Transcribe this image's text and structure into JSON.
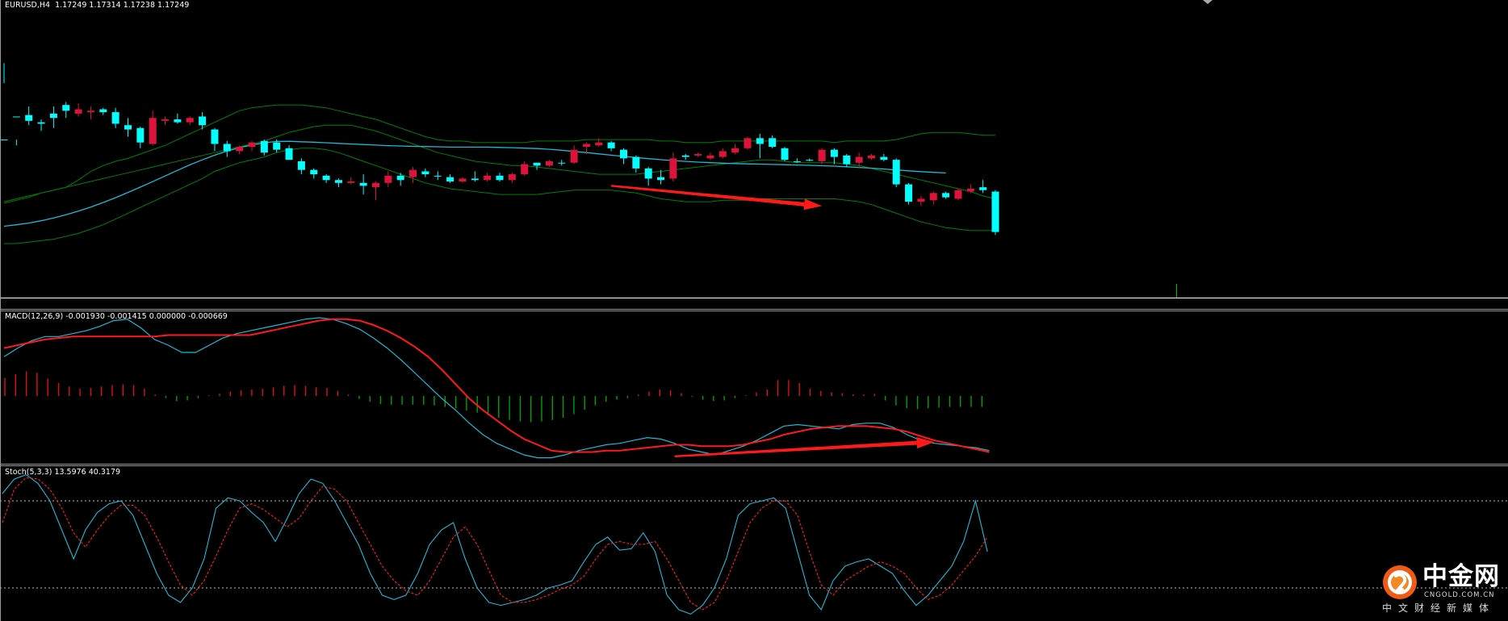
{
  "symbol_header": "EURUSD,H4  1.17249 1.17314 1.17238 1.17249",
  "colors": {
    "background": "#000000",
    "bull_candle": "#dc143c",
    "bear_candle": "#00ffff",
    "bollinger": "#008000",
    "moving_average": "#1fb9d6",
    "macd_line": "#1fb9d6",
    "signal_line": "#ff1a1a",
    "hist_positive": "#dd1111",
    "hist_negative": "#00a000",
    "stoch_main": "#1fb9d6",
    "stoch_signal": "#ff2020",
    "annotation_arrow": "#ff1a1a",
    "separator": "#ffffff"
  },
  "chart_data": [
    {
      "type": "candlestick",
      "title": "EURUSD,H4",
      "ohlc_readout": [
        1.17249,
        1.17314,
        1.17238,
        1.17249
      ],
      "candles": [
        [
          0.1,
          0.1,
          0.63,
          0.49
        ],
        [
          0.26,
          0.26,
          0.1,
          0.06
        ],
        [
          0.27,
          0.23,
          0.33,
          0.2
        ],
        [
          0.22,
          0.21,
          0.24,
          0.16
        ],
        [
          0.28,
          0.25,
          0.33,
          0.18
        ],
        [
          0.34,
          0.3,
          0.36,
          0.25
        ],
        [
          0.28,
          0.31,
          0.35,
          0.26
        ],
        [
          0.29,
          0.3,
          0.33,
          0.24
        ],
        [
          0.31,
          0.29,
          0.32,
          0.27
        ],
        [
          0.29,
          0.21,
          0.32,
          0.18
        ],
        [
          0.2,
          0.17,
          0.25,
          0.12
        ],
        [
          0.18,
          0.08,
          0.19,
          0.04
        ],
        [
          0.07,
          0.25,
          0.3,
          0.06
        ],
        [
          0.23,
          0.24,
          0.26,
          0.2
        ],
        [
          0.24,
          0.22,
          0.28,
          0.21
        ],
        [
          0.22,
          0.25,
          0.26,
          0.2
        ],
        [
          0.26,
          0.2,
          0.29,
          0.17
        ],
        [
          0.17,
          0.07,
          0.18,
          0.02
        ],
        [
          0.07,
          0.02,
          0.09,
          -0.02
        ],
        [
          0.02,
          0.05,
          0.06,
          0.0
        ],
        [
          0.05,
          0.08,
          0.09,
          0.02
        ],
        [
          0.09,
          0.01,
          0.1,
          -0.01
        ],
        [
          0.08,
          0.03,
          0.1,
          0.01
        ],
        [
          0.04,
          -0.04,
          0.06,
          -0.04
        ],
        [
          -0.05,
          -0.11,
          -0.03,
          -0.14
        ],
        [
          -0.11,
          -0.14,
          -0.1,
          -0.17
        ],
        [
          -0.15,
          -0.18,
          -0.14,
          -0.2
        ],
        [
          -0.18,
          -0.2,
          -0.17,
          -0.23
        ],
        [
          -0.2,
          -0.19,
          -0.16,
          -0.21
        ],
        [
          -0.2,
          -0.22,
          -0.14,
          -0.28
        ],
        [
          -0.23,
          -0.2,
          -0.19,
          -0.32
        ],
        [
          -0.2,
          -0.15,
          -0.12,
          -0.23
        ],
        [
          -0.15,
          -0.18,
          -0.13,
          -0.22
        ],
        [
          -0.16,
          -0.11,
          -0.09,
          -0.2
        ],
        [
          -0.12,
          -0.14,
          -0.1,
          -0.16
        ],
        [
          -0.15,
          -0.15,
          -0.12,
          -0.18
        ],
        [
          -0.16,
          -0.19,
          -0.14,
          -0.2
        ],
        [
          -0.19,
          -0.17,
          -0.16,
          -0.2
        ],
        [
          -0.17,
          -0.18,
          -0.12,
          -0.19
        ],
        [
          -0.18,
          -0.15,
          -0.13,
          -0.19
        ],
        [
          -0.15,
          -0.18,
          -0.13,
          -0.19
        ],
        [
          -0.18,
          -0.14,
          -0.13,
          -0.2
        ],
        [
          -0.14,
          -0.07,
          -0.05,
          -0.15
        ],
        [
          -0.06,
          -0.08,
          -0.06,
          -0.11
        ],
        [
          -0.08,
          -0.05,
          -0.04,
          -0.09
        ],
        [
          -0.06,
          -0.06,
          -0.04,
          -0.08
        ],
        [
          -0.06,
          0.03,
          0.06,
          -0.07
        ],
        [
          0.05,
          0.07,
          0.08,
          0.0
        ],
        [
          0.06,
          0.08,
          0.11,
          0.05
        ],
        [
          0.08,
          0.04,
          0.09,
          0.02
        ],
        [
          0.03,
          -0.03,
          0.04,
          -0.07
        ],
        [
          -0.02,
          -0.1,
          -0.01,
          -0.13
        ],
        [
          -0.1,
          -0.17,
          -0.09,
          -0.22
        ],
        [
          -0.16,
          -0.18,
          -0.11,
          -0.21
        ],
        [
          -0.17,
          -0.03,
          0.01,
          -0.19
        ],
        [
          -0.01,
          -0.02,
          0.0,
          -0.04
        ],
        [
          -0.01,
          0.0,
          0.01,
          -0.02
        ],
        [
          -0.03,
          -0.01,
          0.01,
          -0.04
        ],
        [
          -0.02,
          0.02,
          0.04,
          -0.03
        ],
        [
          0.01,
          0.04,
          0.07,
          0.0
        ],
        [
          0.04,
          0.11,
          0.12,
          0.03
        ],
        [
          0.11,
          0.07,
          0.14,
          -0.03
        ],
        [
          0.11,
          0.05,
          0.13,
          0.04
        ],
        [
          0.04,
          -0.04,
          0.05,
          -0.05
        ],
        [
          -0.05,
          -0.05,
          -0.03,
          -0.06
        ],
        [
          -0.04,
          -0.04,
          -0.03,
          -0.05
        ],
        [
          -0.05,
          0.03,
          0.04,
          -0.07
        ],
        [
          0.03,
          -0.02,
          0.04,
          -0.07
        ],
        [
          -0.01,
          -0.07,
          0.0,
          -0.09
        ],
        [
          -0.06,
          -0.02,
          0.01,
          -0.1
        ],
        [
          -0.03,
          -0.01,
          0.0,
          -0.04
        ],
        [
          -0.02,
          -0.04,
          0.0,
          -0.05
        ],
        [
          -0.04,
          -0.21,
          -0.03,
          -0.23
        ],
        [
          -0.21,
          -0.33,
          -0.2,
          -0.35
        ],
        [
          -0.33,
          -0.31,
          -0.29,
          -0.36
        ],
        [
          -0.32,
          -0.27,
          -0.26,
          -0.35
        ],
        [
          -0.27,
          -0.3,
          -0.26,
          -0.31
        ],
        [
          -0.31,
          -0.25,
          -0.24,
          -0.32
        ],
        [
          -0.26,
          -0.24,
          -0.21,
          -0.27
        ],
        [
          -0.23,
          -0.25,
          -0.18,
          -0.27
        ],
        [
          -0.26,
          -0.54,
          -0.25,
          -0.56
        ]
      ],
      "moving_average": [
        -0.5,
        -0.49,
        -0.478,
        -0.462,
        -0.443,
        -0.42,
        -0.395,
        -0.367,
        -0.336,
        -0.302,
        -0.266,
        -0.229,
        -0.191,
        -0.152,
        -0.113,
        -0.075,
        -0.04,
        -0.008,
        0.02,
        0.044,
        0.063,
        0.078,
        0.087,
        0.088,
        0.085,
        0.082,
        0.078,
        0.074,
        0.07,
        0.066,
        0.062,
        0.058,
        0.056,
        0.053,
        0.052,
        0.05,
        0.048,
        0.048,
        0.048,
        0.048,
        0.046,
        0.044,
        0.041,
        0.038,
        0.033,
        0.026,
        0.018,
        0.01,
        0.001,
        -0.008,
        -0.016,
        -0.024,
        -0.032,
        -0.039,
        -0.045,
        -0.051,
        -0.056,
        -0.06,
        -0.063,
        -0.066,
        -0.068,
        -0.07,
        -0.072,
        -0.074,
        -0.076,
        -0.078,
        -0.081,
        -0.084,
        -0.088,
        -0.093,
        -0.098,
        -0.104,
        -0.11,
        -0.116,
        -0.122,
        -0.127,
        -0.131
      ],
      "bollinger_upper": [
        -0.34,
        -0.32,
        -0.3,
        -0.27,
        -0.25,
        -0.23,
        -0.18,
        -0.12,
        -0.08,
        -0.05,
        -0.03,
        0.0,
        0.03,
        0.06,
        0.1,
        0.14,
        0.18,
        0.22,
        0.26,
        0.3,
        0.32,
        0.33,
        0.34,
        0.34,
        0.34,
        0.33,
        0.32,
        0.3,
        0.28,
        0.26,
        0.24,
        0.21,
        0.18,
        0.15,
        0.12,
        0.1,
        0.09,
        0.09,
        0.08,
        0.08,
        0.08,
        0.08,
        0.08,
        0.09,
        0.09,
        0.09,
        0.09,
        0.1,
        0.1,
        0.1,
        0.1,
        0.1,
        0.1,
        0.09,
        0.09,
        0.08,
        0.08,
        0.08,
        0.09,
        0.09,
        0.09,
        0.09,
        0.09,
        0.09,
        0.09,
        0.09,
        0.09,
        0.08,
        0.09,
        0.09,
        0.09,
        0.09,
        0.1,
        0.12,
        0.14,
        0.15,
        0.15,
        0.15,
        0.14,
        0.13,
        0.13
      ],
      "bollinger_middle": [
        -0.33,
        -0.31,
        -0.29,
        -0.27,
        -0.25,
        -0.23,
        -0.21,
        -0.19,
        -0.17,
        -0.15,
        -0.13,
        -0.11,
        -0.09,
        -0.07,
        -0.05,
        -0.03,
        -0.01,
        0.01,
        0.03,
        0.05,
        0.07,
        0.09,
        0.12,
        0.15,
        0.17,
        0.19,
        0.2,
        0.2,
        0.2,
        0.18,
        0.16,
        0.13,
        0.1,
        0.07,
        0.04,
        0.01,
        -0.01,
        -0.03,
        -0.05,
        -0.06,
        -0.07,
        -0.08,
        -0.08,
        -0.09,
        -0.1,
        -0.11,
        -0.12,
        -0.13,
        -0.14,
        -0.14,
        -0.14,
        -0.14,
        -0.13,
        -0.12,
        -0.11,
        -0.1,
        -0.09,
        -0.08,
        -0.07,
        -0.06,
        -0.05,
        -0.04,
        -0.04,
        -0.05,
        -0.06,
        -0.06,
        -0.06,
        -0.06,
        -0.07,
        -0.08,
        -0.1,
        -0.12,
        -0.14,
        -0.16,
        -0.18,
        -0.2,
        -0.22,
        -0.24,
        -0.26,
        -0.29,
        -0.31
      ],
      "bollinger_lower": [
        -0.62,
        -0.62,
        -0.61,
        -0.6,
        -0.59,
        -0.57,
        -0.55,
        -0.52,
        -0.49,
        -0.45,
        -0.41,
        -0.37,
        -0.33,
        -0.29,
        -0.25,
        -0.21,
        -0.17,
        -0.12,
        -0.09,
        -0.06,
        -0.04,
        -0.02,
        0.01,
        0.03,
        0.04,
        0.04,
        0.03,
        0.01,
        -0.02,
        -0.05,
        -0.08,
        -0.11,
        -0.14,
        -0.17,
        -0.2,
        -0.22,
        -0.24,
        -0.25,
        -0.26,
        -0.27,
        -0.28,
        -0.28,
        -0.28,
        -0.28,
        -0.27,
        -0.26,
        -0.25,
        -0.25,
        -0.25,
        -0.25,
        -0.26,
        -0.27,
        -0.29,
        -0.31,
        -0.32,
        -0.33,
        -0.33,
        -0.33,
        -0.32,
        -0.32,
        -0.32,
        -0.31,
        -0.31,
        -0.31,
        -0.31,
        -0.31,
        -0.31,
        -0.31,
        -0.32,
        -0.33,
        -0.35,
        -0.38,
        -0.41,
        -0.44,
        -0.47,
        -0.49,
        -0.51,
        -0.52,
        -0.53,
        -0.53,
        -0.53
      ],
      "annotation_arrow": {
        "from_bar": 49,
        "from_value": -0.22,
        "to_bar": 66,
        "to_value": -0.36
      }
    },
    {
      "type": "line",
      "title": "MACD(12,26,9)",
      "readout": "-0.001930 -0.001415 0.000000 -0.000669",
      "macd": [
        0.73,
        0.79,
        0.84,
        0.87,
        0.87,
        0.89,
        0.91,
        0.94,
        0.98,
        0.99,
        0.93,
        0.85,
        0.81,
        0.76,
        0.76,
        0.81,
        0.86,
        0.89,
        0.91,
        0.93,
        0.95,
        0.97,
        0.99,
        1.0,
        0.99,
        0.96,
        0.92,
        0.86,
        0.79,
        0.71,
        0.62,
        0.53,
        0.44,
        0.36,
        0.27,
        0.19,
        0.13,
        0.09,
        0.05,
        0.03,
        0.03,
        0.05,
        0.08,
        0.1,
        0.12,
        0.13,
        0.15,
        0.17,
        0.16,
        0.13,
        0.09,
        0.07,
        0.05,
        0.08,
        0.11,
        0.15,
        0.2,
        0.25,
        0.26,
        0.25,
        0.24,
        0.23,
        0.26,
        0.27,
        0.27,
        0.24,
        0.19,
        0.15,
        0.13,
        0.12,
        0.11,
        0.1,
        0.08
      ],
      "signal": [
        0.79,
        0.81,
        0.83,
        0.85,
        0.86,
        0.87,
        0.87,
        0.87,
        0.87,
        0.87,
        0.87,
        0.87,
        0.88,
        0.88,
        0.88,
        0.88,
        0.88,
        0.88,
        0.88,
        0.9,
        0.92,
        0.94,
        0.96,
        0.98,
        0.99,
        0.99,
        0.98,
        0.95,
        0.91,
        0.86,
        0.8,
        0.73,
        0.64,
        0.54,
        0.44,
        0.36,
        0.29,
        0.22,
        0.16,
        0.12,
        0.08,
        0.07,
        0.07,
        0.07,
        0.08,
        0.08,
        0.09,
        0.1,
        0.11,
        0.12,
        0.12,
        0.11,
        0.11,
        0.11,
        0.12,
        0.14,
        0.16,
        0.19,
        0.21,
        0.23,
        0.24,
        0.25,
        0.25,
        0.25,
        0.24,
        0.23,
        0.21,
        0.18,
        0.15,
        0.13,
        0.11,
        0.09,
        0.07
      ],
      "histogram": [
        0.25,
        0.3,
        0.34,
        0.32,
        0.24,
        0.18,
        0.13,
        0.1,
        0.11,
        0.13,
        0.15,
        0.16,
        0.15,
        0.1,
        0.02,
        -0.03,
        -0.07,
        -0.06,
        -0.03,
        0.01,
        0.03,
        0.06,
        0.08,
        0.09,
        0.1,
        0.12,
        0.14,
        0.15,
        0.14,
        0.12,
        0.11,
        0.07,
        0.02,
        -0.04,
        -0.08,
        -0.11,
        -0.12,
        -0.12,
        -0.12,
        -0.12,
        -0.13,
        -0.15,
        -0.17,
        -0.2,
        -0.23,
        -0.26,
        -0.3,
        -0.33,
        -0.35,
        -0.36,
        -0.35,
        -0.33,
        -0.3,
        -0.25,
        -0.19,
        -0.13,
        -0.08,
        -0.05,
        -0.03,
        0.02,
        0.06,
        0.09,
        0.08,
        0.04,
        -0.01,
        -0.05,
        -0.07,
        -0.06,
        -0.03,
        0.01,
        0.05,
        0.09,
        0.22,
        0.22,
        0.18,
        0.1,
        0.07,
        0.05,
        0.04,
        0.02,
        0.02,
        0.03,
        -0.06,
        -0.13,
        -0.17,
        -0.18,
        -0.17,
        -0.16,
        -0.15,
        -0.15,
        -0.15,
        -0.15
      ],
      "annotation_arrow": {
        "from_bar": 49,
        "from_value": 0.04,
        "to_bar": 68,
        "to_value": 0.14
      }
    },
    {
      "type": "line",
      "title": "Stoch(5,3,3)",
      "readout": "13.5976 40.3179",
      "levels": [
        80,
        20
      ],
      "main": [
        85,
        95,
        98,
        92,
        80,
        60,
        40,
        60,
        72,
        78,
        80,
        70,
        50,
        30,
        15,
        10,
        20,
        40,
        75,
        82,
        80,
        72,
        65,
        52,
        68,
        85,
        95,
        92,
        80,
        65,
        50,
        30,
        15,
        12,
        15,
        30,
        50,
        60,
        65,
        40,
        20,
        10,
        8,
        10,
        12,
        15,
        20,
        22,
        25,
        38,
        50,
        55,
        46,
        47,
        58,
        45,
        15,
        5,
        2,
        8,
        20,
        40,
        70,
        78,
        80,
        82,
        75,
        45,
        15,
        5,
        25,
        35,
        38,
        40,
        35,
        30,
        18,
        8,
        15,
        25,
        35,
        52,
        80,
        45
      ],
      "signal": [
        65,
        88,
        96,
        95,
        88,
        75,
        58,
        48,
        60,
        70,
        77,
        77,
        70,
        55,
        38,
        22,
        15,
        25,
        42,
        60,
        75,
        78,
        74,
        68,
        62,
        68,
        80,
        90,
        88,
        80,
        65,
        50,
        35,
        25,
        18,
        15,
        25,
        40,
        55,
        62,
        50,
        32,
        15,
        10,
        10,
        12,
        15,
        19,
        22,
        28,
        40,
        50,
        52,
        50,
        50,
        52,
        40,
        25,
        10,
        5,
        10,
        25,
        45,
        65,
        75,
        80,
        80,
        70,
        45,
        22,
        15,
        25,
        30,
        35,
        38,
        35,
        30,
        20,
        12,
        15,
        22,
        32,
        42,
        55
      ]
    }
  ],
  "watermark": {
    "title": "中金网",
    "domain": "CNGOLD.COM.CN",
    "subtitle": "中文财经新媒体"
  }
}
